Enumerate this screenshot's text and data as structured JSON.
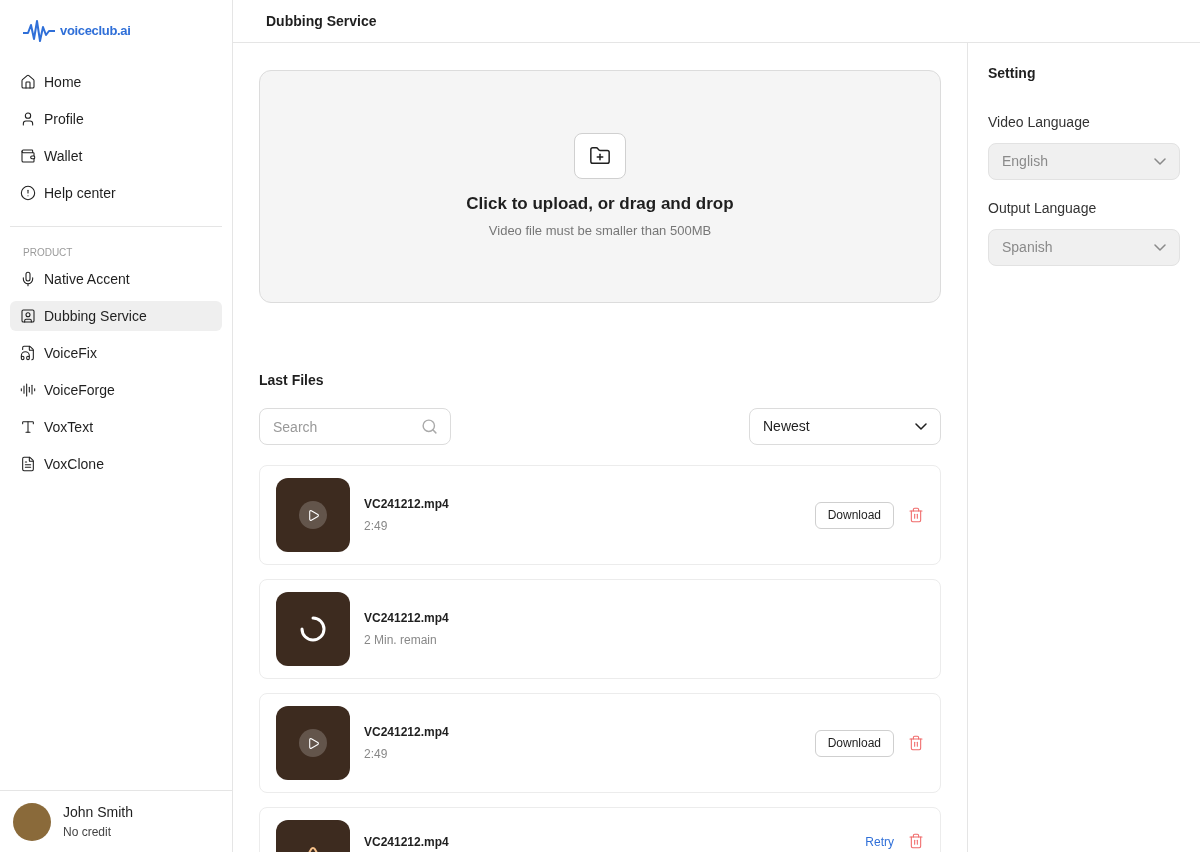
{
  "logo": {
    "text": "voiceclub.ai"
  },
  "nav": [
    {
      "label": "Home",
      "selected": false
    },
    {
      "label": "Profile",
      "selected": false
    },
    {
      "label": "Wallet",
      "selected": false
    },
    {
      "label": "Help center",
      "selected": false
    }
  ],
  "product_section": {
    "heading": "PRODUCT",
    "items": [
      {
        "label": "Native Accent",
        "selected": false
      },
      {
        "label": "Dubbing Service",
        "selected": true
      },
      {
        "label": "VoiceFix",
        "selected": false
      },
      {
        "label": "VoiceForge",
        "selected": false
      },
      {
        "label": "VoxText",
        "selected": false
      },
      {
        "label": "VoxClone",
        "selected": false
      }
    ]
  },
  "user": {
    "name": "John Smith",
    "credit": "No credit"
  },
  "header": {
    "title": "Dubbing Service"
  },
  "upload": {
    "title": "Click to upload, or drag and drop",
    "hint": "Video file must be smaller than 500MB"
  },
  "last_files": {
    "title": "Last Files",
    "search": {
      "placeholder": "Search"
    },
    "sort": {
      "value": "Newest"
    },
    "files": [
      {
        "kind": "done",
        "name": "VC241212.mp4",
        "detail": "2:49",
        "action": "Download"
      },
      {
        "kind": "processing",
        "name": "VC241212.mp4",
        "detail": "2 Min. remain"
      },
      {
        "kind": "done",
        "name": "VC241212.mp4",
        "detail": "2:49",
        "action": "Download"
      },
      {
        "kind": "failed",
        "name": "VC241212.mp4",
        "action": "Retry"
      }
    ]
  },
  "settings": {
    "title": "Setting",
    "fields": [
      {
        "label": "Video Language",
        "value": "English",
        "disabled": true
      },
      {
        "label": "Output Language",
        "value": "Spanish",
        "disabled": true
      }
    ]
  }
}
